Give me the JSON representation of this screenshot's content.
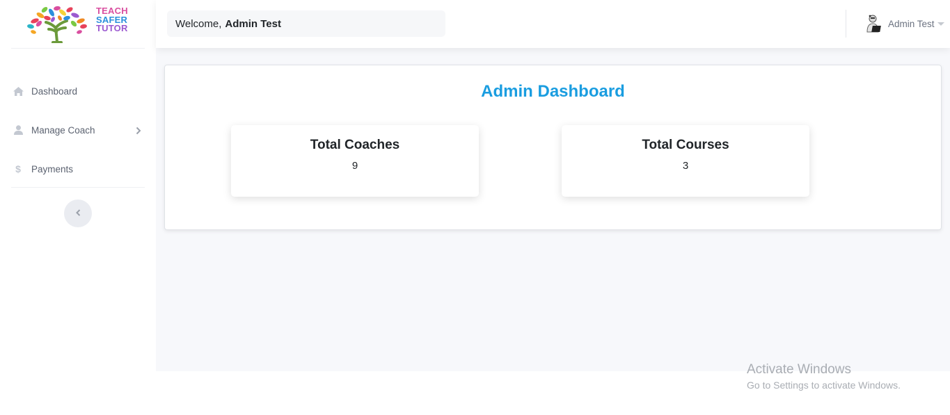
{
  "brand": {
    "logo_lines": [
      "TEACH",
      "SAFER",
      "TUTOR"
    ],
    "colors": {
      "teach": "#d94fa0",
      "safer": "#2b8fdc",
      "tutor": "#9b59d0"
    }
  },
  "header": {
    "welcome_prefix": "Welcome,",
    "welcome_user": "Admin Test",
    "user_menu_label": "Admin Test"
  },
  "sidebar": {
    "items": [
      {
        "label": "Dashboard",
        "icon": "home-icon"
      },
      {
        "label": "Manage Coach",
        "icon": "user-icon",
        "has_submenu": true
      },
      {
        "label": "Payments",
        "icon": "dollar-icon"
      }
    ],
    "collapse_icon": "chevron-left-icon"
  },
  "main": {
    "title": "Admin Dashboard",
    "title_color": "#1a9de0",
    "stats": [
      {
        "label": "Total Coaches",
        "value": "9"
      },
      {
        "label": "Total Courses",
        "value": "3"
      }
    ]
  },
  "watermark": {
    "title": "Activate Windows",
    "subtitle": "Go to Settings to activate Windows."
  }
}
